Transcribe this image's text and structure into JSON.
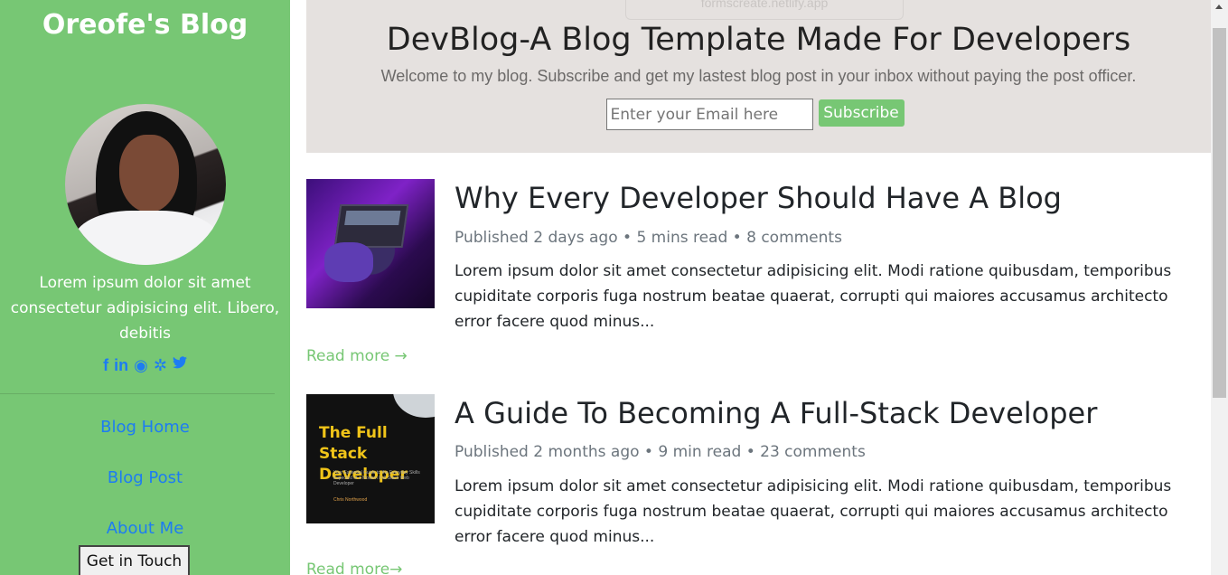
{
  "sidebar": {
    "title": "Oreofe's Blog",
    "bio": "Lorem ipsum dolor sit amet consectetur adipisicing elit. Libero, debitis",
    "social": [
      {
        "icon": "facebook-icon",
        "glyph": "f"
      },
      {
        "icon": "linkedin-icon",
        "glyph": "in"
      },
      {
        "icon": "github-icon",
        "glyph": "◉"
      },
      {
        "icon": "slack-icon",
        "glyph": "✲"
      },
      {
        "icon": "twitter-icon",
        "glyph": "🐦"
      }
    ],
    "nav": [
      "Blog Home",
      "Blog Post",
      "About Me"
    ],
    "cta": "Get in Touch"
  },
  "header": {
    "ghost_text": "formscreate.netlify.app",
    "title": "DevBlog-A Blog Template Made For Developers",
    "subtitle": "Welcome to my blog. Subscribe and get my lastest blog post in your inbox without paying the post officer.",
    "email_placeholder": "Enter your Email here",
    "subscribe_label": "Subscribe"
  },
  "posts": [
    {
      "title": "Why Every Developer Should Have A Blog",
      "meta": "Published 2 days ago • 5 mins read • 8 comments",
      "excerpt": "Lorem ipsum dolor sit amet consectetur adipisicing elit. Modi ratione quibusdam, temporibus cupiditate corporis fuga nostrum beatae quaerat, corrupti qui maiores accusamus architecto error facere quod minus...",
      "read_more": "Read more →"
    },
    {
      "title": "A Guide To Becoming A Full-Stack Developer",
      "meta": "Published 2 months ago • 9 min read • 23 comments",
      "excerpt": "Lorem ipsum dolor sit amet consectetur adipisicing elit. Modi ratione quibusdam, temporibus cupiditate corporis fuga nostrum beatae quaerat, corrupti qui maiores accusamus architecto error facere quod minus...",
      "read_more": "Read more→",
      "cover_title": "The Full Stack Developer",
      "cover_subtitle": "Your Essential Guide to the Everyday Skills Expected of a Modern Full Stack Web Developer",
      "cover_author": "Chris Northwood"
    }
  ],
  "colors": {
    "brand_green": "#77c774",
    "link_blue": "#1d7cf2",
    "header_bg": "#e5e1df"
  }
}
